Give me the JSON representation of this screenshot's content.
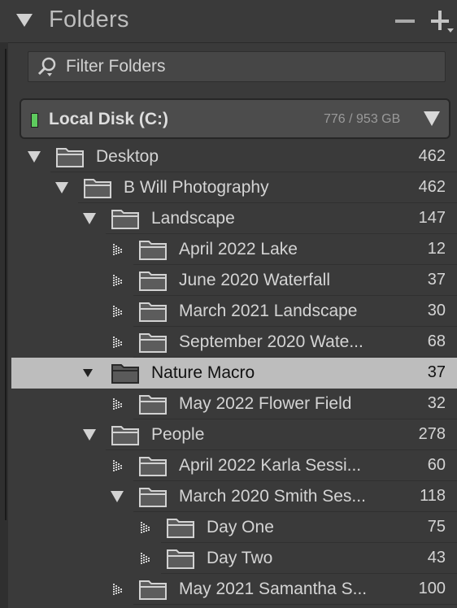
{
  "panel": {
    "title": "Folders",
    "filter_placeholder": "Filter Folders"
  },
  "volume": {
    "name": "Local Disk (C:)",
    "usage": "776 / 953 GB",
    "status_color": "#5ecb5e"
  },
  "folders": [
    {
      "name": "Desktop",
      "count": "462",
      "expanded": true,
      "selected": false
    },
    {
      "name": "B Will Photography",
      "count": "462",
      "expanded": true,
      "selected": false
    },
    {
      "name": "Landscape",
      "count": "147",
      "expanded": true,
      "selected": false
    },
    {
      "name": "April 2022 Lake",
      "count": "12",
      "expanded": false,
      "selected": false
    },
    {
      "name": "June 2020 Waterfall",
      "count": "37",
      "expanded": false,
      "selected": false
    },
    {
      "name": "March 2021 Landscape",
      "count": "30",
      "expanded": false,
      "selected": false
    },
    {
      "name": "September 2020 Wate...",
      "count": "68",
      "expanded": false,
      "selected": false
    },
    {
      "name": "Nature Macro",
      "count": "37",
      "expanded": true,
      "selected": true
    },
    {
      "name": "May 2022 Flower Field",
      "count": "32",
      "expanded": false,
      "selected": false
    },
    {
      "name": "People",
      "count": "278",
      "expanded": true,
      "selected": false
    },
    {
      "name": "April 2022 Karla Sessi...",
      "count": "60",
      "expanded": false,
      "selected": false
    },
    {
      "name": "March 2020 Smith Ses...",
      "count": "118",
      "expanded": true,
      "selected": false
    },
    {
      "name": "Day One",
      "count": "75",
      "expanded": false,
      "selected": false
    },
    {
      "name": "Day Two",
      "count": "43",
      "expanded": false,
      "selected": false
    },
    {
      "name": "May 2021 Samantha S...",
      "count": "100",
      "expanded": false,
      "selected": false
    }
  ],
  "colors": {
    "panel_bg": "#3a3a3a",
    "selected_row_bg": "#bdbdbd",
    "text": "#d4d4d4"
  }
}
